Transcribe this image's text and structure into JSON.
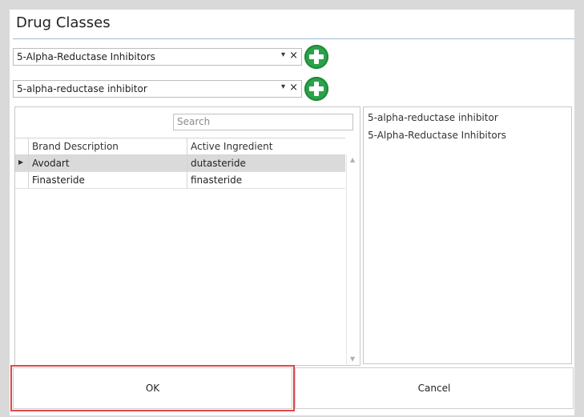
{
  "dialog": {
    "title": "Drug Classes"
  },
  "selectors": [
    {
      "value": "5-Alpha-Reductase Inhibitors",
      "clear": "×",
      "arrow": "▾"
    },
    {
      "value": "5-alpha-reductase inhibitor",
      "clear": "×",
      "arrow": "▾"
    }
  ],
  "grid": {
    "search_placeholder": "Search",
    "columns": [
      "Brand Description",
      "Active Ingredient"
    ],
    "rows": [
      {
        "brand": "Avodart",
        "ingredient": "dutasteride",
        "selected": true
      },
      {
        "brand": "Finasteride",
        "ingredient": "finasteride",
        "selected": false
      }
    ]
  },
  "classes_list": [
    "5-alpha-reductase inhibitor",
    "5-Alpha-Reductase Inhibitors"
  ],
  "buttons": {
    "ok": "OK",
    "cancel": "Cancel"
  },
  "colors": {
    "add_button": "#2ba24a",
    "ok_highlight": "#e0474c",
    "title_rule": "#9fb9d8"
  }
}
